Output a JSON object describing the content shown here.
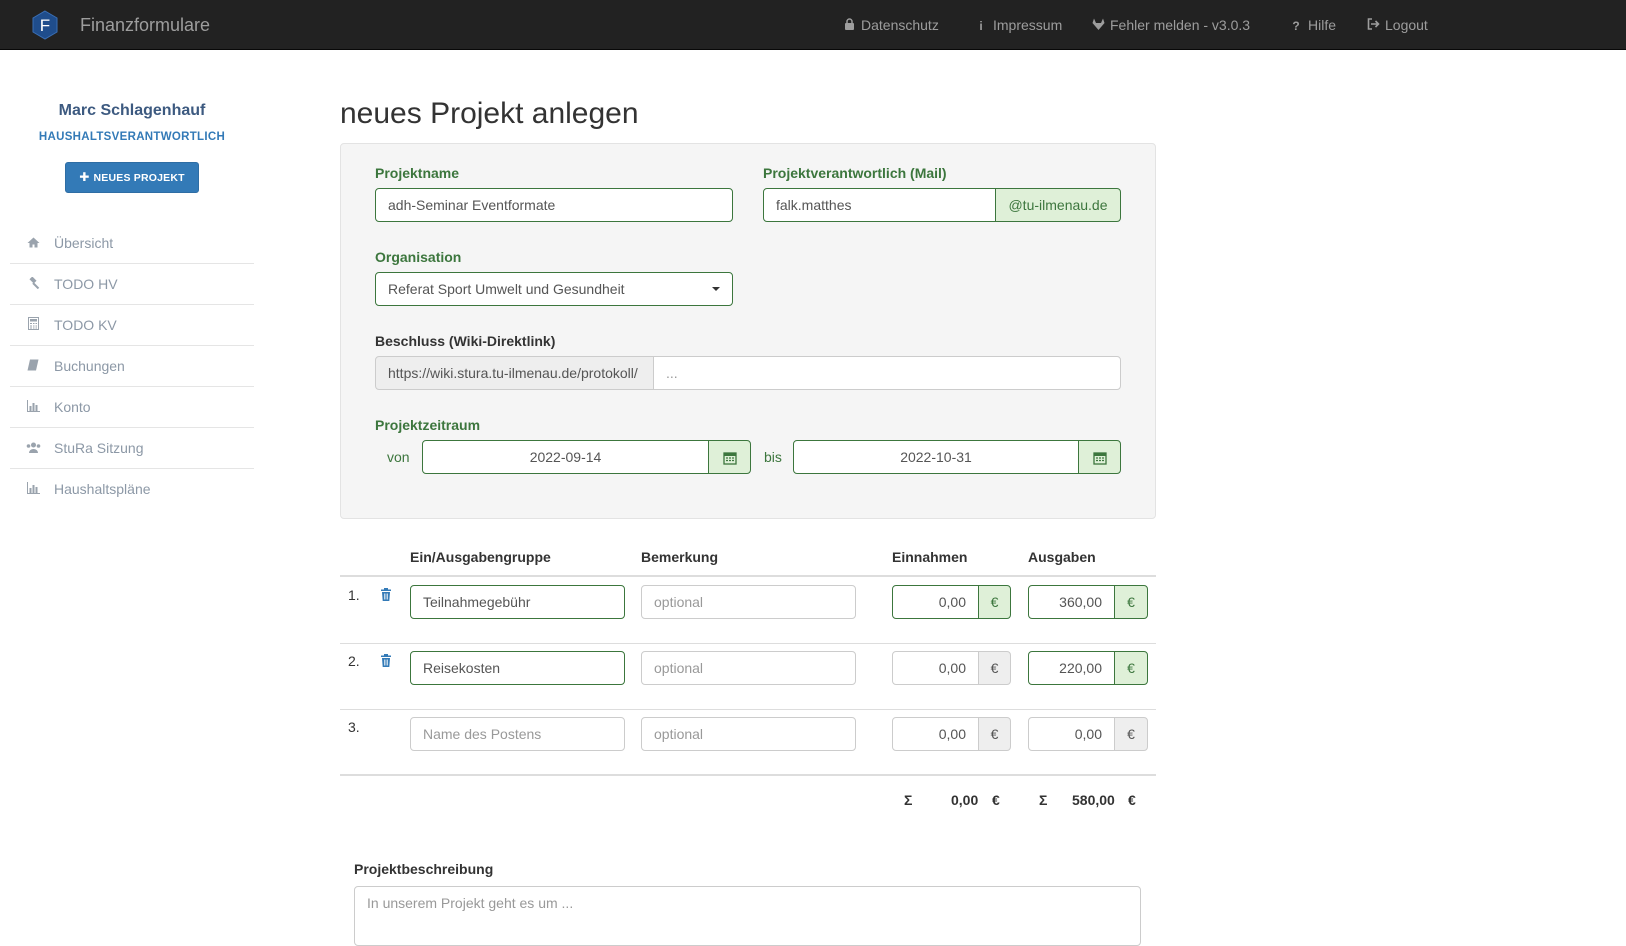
{
  "navbar": {
    "logo_letter": "F",
    "brand": "Finanzformulare",
    "items": [
      {
        "icon": "lock-icon",
        "label": "Datenschutz"
      },
      {
        "icon": "info-icon",
        "label": "Impressum"
      },
      {
        "icon": "gitlab-icon",
        "label": "Fehler melden - v3.0.3"
      },
      {
        "icon": "question-icon",
        "label": "Hilfe"
      },
      {
        "icon": "logout-icon",
        "label": "Logout"
      }
    ]
  },
  "sidebar": {
    "user_name": "Marc Schlagenhauf",
    "user_role": "HAUSHALTSVERANTWORTLICH",
    "new_project_label": "NEUES PROJEKT",
    "items": [
      {
        "icon": "home-icon",
        "label": "Übersicht"
      },
      {
        "icon": "gavel-icon",
        "label": "TODO HV"
      },
      {
        "icon": "calculator-icon",
        "label": "TODO KV"
      },
      {
        "icon": "book-icon",
        "label": "Buchungen"
      },
      {
        "icon": "bar-chart-icon",
        "label": "Konto"
      },
      {
        "icon": "users-icon",
        "label": "StuRa Sitzung"
      },
      {
        "icon": "bar-chart-icon",
        "label": "Haushaltspläne"
      }
    ]
  },
  "main": {
    "title": "neues Projekt anlegen",
    "form": {
      "project_name_label": "Projektname",
      "project_name_value": "adh-Seminar Eventformate",
      "responsible_label": "Projektverantwortlich (Mail)",
      "responsible_value": "falk.matthes",
      "responsible_domain": "@tu-ilmenau.de",
      "org_label": "Organisation",
      "org_value": "Referat Sport Umwelt und Gesundheit",
      "resolution_label": "Beschluss (Wiki-Direktlink)",
      "resolution_prefix": "https://wiki.stura.tu-ilmenau.de/protokoll/",
      "resolution_placeholder": "...",
      "period_label": "Projektzeitraum",
      "from_label": "von",
      "from_value": "2022-09-14",
      "to_label": "bis",
      "to_value": "2022-10-31"
    },
    "table": {
      "headers": {
        "group": "Ein/Ausgabengruppe",
        "remark": "Bemerkung",
        "income": "Einnahmen",
        "expense": "Ausgaben"
      },
      "currency": "€",
      "rows": [
        {
          "num": "1.",
          "group": "Teilnahmegebühr",
          "remark": "optional",
          "income": "0,00",
          "expense": "360,00"
        },
        {
          "num": "2.",
          "group": "Reisekosten",
          "remark": "optional",
          "income": "0,00",
          "expense": "220,00"
        },
        {
          "num": "3.",
          "group": "Name des Postens",
          "remark": "optional",
          "income": "0,00",
          "expense": "0,00"
        }
      ],
      "sum_symbol": "Σ",
      "sum_income": "0,00",
      "sum_expense": "580,00"
    },
    "description_label": "Projektbeschreibung",
    "description_placeholder": "In unserem Projekt geht es um ..."
  },
  "colors": {
    "success": "#3c763d",
    "success_bg": "#dff0d8",
    "primary": "#337ab7",
    "navbar": "#222222"
  }
}
